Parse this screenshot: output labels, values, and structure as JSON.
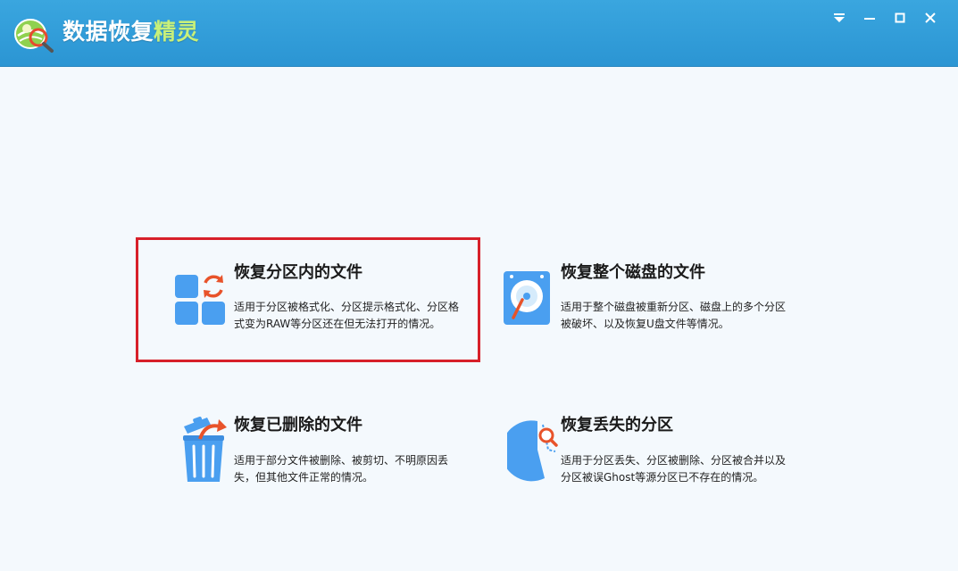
{
  "titlebar": {
    "title_main": "数据恢复",
    "title_accent": "精灵",
    "controls": {
      "menu_icon": "dropdown-menu-icon",
      "minimize_icon": "minimize-icon",
      "maximize_icon": "maximize-icon",
      "close_icon": "close-icon"
    }
  },
  "options": [
    {
      "title": "恢复分区内的文件",
      "desc": "适用于分区被格式化、分区提示格式化、分区格式变为RAW等分区还在但无法打开的情况。",
      "icon": "partition-restore-icon",
      "highlighted": true
    },
    {
      "title": "恢复整个磁盘的文件",
      "desc": "适用于整个磁盘被重新分区、磁盘上的多个分区被破坏、以及恢复U盘文件等情况。",
      "icon": "hard-disk-icon",
      "highlighted": false
    },
    {
      "title": "恢复已删除的文件",
      "desc": "适用于部分文件被删除、被剪切、不明原因丢失，但其他文件正常的情况。",
      "icon": "recycle-bin-icon",
      "highlighted": false
    },
    {
      "title": "恢复丢失的分区",
      "desc": "适用于分区丢失、分区被删除、分区被合并以及分区被误Ghost等源分区已不存在的情况。",
      "icon": "lost-partition-search-icon",
      "highlighted": false
    }
  ],
  "colors": {
    "titlebar": "#2b95d3",
    "background": "#f4f9fd",
    "icon_blue": "#4a9ff0",
    "icon_orange": "#e8532a",
    "highlight_border": "#d7202a",
    "title_accent": "#c8f07a"
  }
}
